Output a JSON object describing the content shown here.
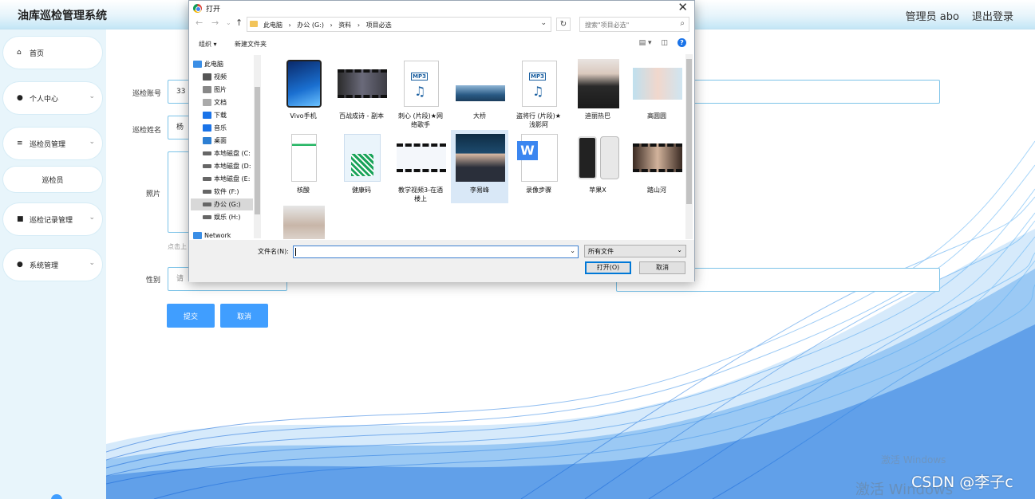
{
  "app": {
    "title": "油库巡检管理系统",
    "user": "管理员 abo",
    "logout": "退出登录"
  },
  "sidebar": {
    "items": [
      {
        "label": "首页"
      },
      {
        "label": "个人中心"
      },
      {
        "label": "巡检员管理"
      },
      {
        "label": "巡检员"
      },
      {
        "label": "巡检记录管理"
      },
      {
        "label": "系统管理"
      }
    ]
  },
  "form": {
    "account_label": "巡检账号",
    "account_value": "33",
    "name_label": "巡检姓名",
    "name_value": "杨",
    "photo_label": "照片",
    "photo_hint": "点击上",
    "gender_label": "性别",
    "gender_placeholder": "请",
    "submit": "提交",
    "cancel": "取消"
  },
  "dialog": {
    "title": "打开",
    "breadcrumbs": [
      "此电脑",
      "›",
      "办公 (G:)",
      "›",
      "资料",
      "›",
      "项目必选"
    ],
    "search_placeholder": "搜索\"项目必选\"",
    "organize": "组织 ▾",
    "new_folder": "新建文件夹",
    "tree": [
      {
        "label": "此电脑",
        "color": "#3a8ee6"
      },
      {
        "label": "视频",
        "color": "#555555"
      },
      {
        "label": "图片",
        "color": "#888888"
      },
      {
        "label": "文档",
        "color": "#aaaaaa"
      },
      {
        "label": "下载",
        "color": "#1a73e8"
      },
      {
        "label": "音乐",
        "color": "#1a73e8"
      },
      {
        "label": "桌面",
        "color": "#2d7fd3"
      },
      {
        "label": "本地磁盘 (C:",
        "color": "#666666"
      },
      {
        "label": "本地磁盘 (D:",
        "color": "#666666"
      },
      {
        "label": "本地磁盘 (E:",
        "color": "#666666"
      },
      {
        "label": "软件 (F:)",
        "color": "#666666"
      },
      {
        "label": "办公 (G:)",
        "color": "#666666"
      },
      {
        "label": "娱乐 (H:)",
        "color": "#666666"
      },
      {
        "label": "Network",
        "color": "#3a8ee6"
      }
    ],
    "files": [
      {
        "name": "Vivo手机"
      },
      {
        "name": "百战成诗 - 副本"
      },
      {
        "name": "刺心 (片段)★网\n络歌手"
      },
      {
        "name": "大桥"
      },
      {
        "name": "盗将行 (片段)★\n浅影阿"
      },
      {
        "name": "迪丽热巴"
      },
      {
        "name": "高圆圆"
      },
      {
        "name": "核酸"
      },
      {
        "name": "健康码"
      },
      {
        "name": "教学视频3-在酒\n楼上"
      },
      {
        "name": "李易峰"
      },
      {
        "name": "录像步骤"
      },
      {
        "name": "苹果X"
      },
      {
        "name": "踏山河"
      },
      {
        "name": ""
      }
    ],
    "filename_label": "文件名(N):",
    "filename_value": "",
    "filetype": "所有文件",
    "open_btn": "打开(O)",
    "cancel_btn": "取消"
  },
  "watermark": {
    "line1": "激活 Windows",
    "line2": "激活 Windows",
    "csdn": "CSDN @李子c"
  },
  "colors": {
    "accent": "#409eff",
    "input_border": "#7cc3e8",
    "sidebar_bg": "#e8f5fb"
  }
}
